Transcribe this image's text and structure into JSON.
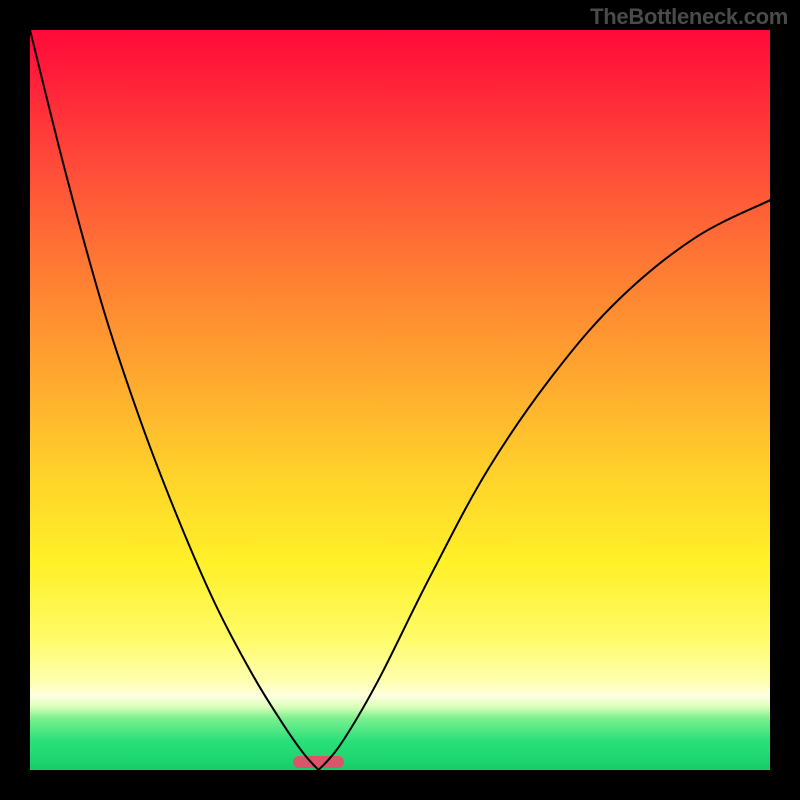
{
  "watermark": "TheBottleneck.com",
  "chart_data": {
    "type": "line",
    "title": "",
    "xlabel": "",
    "ylabel": "",
    "xlim": [
      0,
      1
    ],
    "ylim": [
      0,
      1
    ],
    "notch_x": 0.39,
    "marker": {
      "x_start": 0.355,
      "x_end": 0.425,
      "y": 0
    },
    "series": [
      {
        "name": "left-branch",
        "x": [
          0.0,
          0.05,
          0.1,
          0.15,
          0.2,
          0.25,
          0.3,
          0.34,
          0.37,
          0.39
        ],
        "y": [
          1.0,
          0.8,
          0.62,
          0.47,
          0.34,
          0.225,
          0.13,
          0.065,
          0.022,
          0.0
        ]
      },
      {
        "name": "right-branch",
        "x": [
          0.39,
          0.42,
          0.47,
          0.54,
          0.62,
          0.71,
          0.8,
          0.9,
          1.0
        ],
        "y": [
          0.0,
          0.035,
          0.12,
          0.26,
          0.408,
          0.538,
          0.64,
          0.72,
          0.77
        ]
      }
    ],
    "gradient_stops": [
      {
        "pos": 0.0,
        "color": "#ff0a3a"
      },
      {
        "pos": 0.32,
        "color": "#ff7a33"
      },
      {
        "pos": 0.6,
        "color": "#ffd22b"
      },
      {
        "pos": 0.88,
        "color": "#ffffb0"
      },
      {
        "pos": 0.93,
        "color": "#7cf08f"
      },
      {
        "pos": 1.0,
        "color": "#18c968"
      }
    ]
  }
}
